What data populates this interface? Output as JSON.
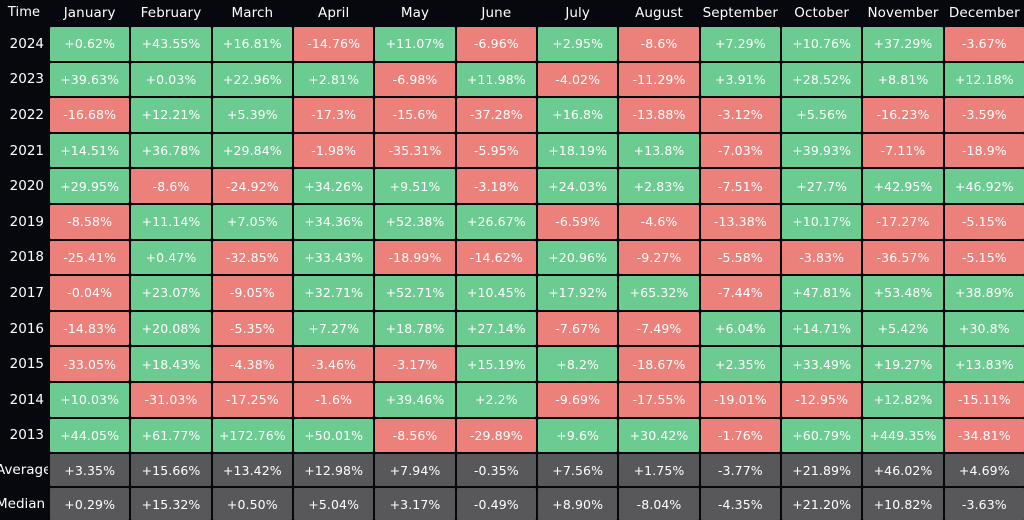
{
  "table": {
    "corner_label": "Time",
    "columns": [
      "January",
      "February",
      "March",
      "April",
      "May",
      "June",
      "July",
      "August",
      "September",
      "October",
      "November",
      "December"
    ],
    "colors": {
      "positive": "#6bcb90",
      "negative": "#ec807a",
      "neutral": "#58585a",
      "background": "#07080d",
      "text": "#ffffff"
    },
    "rows": [
      {
        "label": "2024",
        "type": "year",
        "values": [
          "+0.62%",
          "+43.55%",
          "+16.81%",
          "-14.76%",
          "+11.07%",
          "-6.96%",
          "+2.95%",
          "-8.6%",
          "+7.29%",
          "+10.76%",
          "+37.29%",
          "-3.67%"
        ]
      },
      {
        "label": "2023",
        "type": "year",
        "values": [
          "+39.63%",
          "+0.03%",
          "+22.96%",
          "+2.81%",
          "-6.98%",
          "+11.98%",
          "-4.02%",
          "-11.29%",
          "+3.91%",
          "+28.52%",
          "+8.81%",
          "+12.18%"
        ]
      },
      {
        "label": "2022",
        "type": "year",
        "values": [
          "-16.68%",
          "+12.21%",
          "+5.39%",
          "-17.3%",
          "-15.6%",
          "-37.28%",
          "+16.8%",
          "-13.88%",
          "-3.12%",
          "+5.56%",
          "-16.23%",
          "-3.59%"
        ]
      },
      {
        "label": "2021",
        "type": "year",
        "values": [
          "+14.51%",
          "+36.78%",
          "+29.84%",
          "-1.98%",
          "-35.31%",
          "-5.95%",
          "+18.19%",
          "+13.8%",
          "-7.03%",
          "+39.93%",
          "-7.11%",
          "-18.9%"
        ]
      },
      {
        "label": "2020",
        "type": "year",
        "values": [
          "+29.95%",
          "-8.6%",
          "-24.92%",
          "+34.26%",
          "+9.51%",
          "-3.18%",
          "+24.03%",
          "+2.83%",
          "-7.51%",
          "+27.7%",
          "+42.95%",
          "+46.92%"
        ]
      },
      {
        "label": "2019",
        "type": "year",
        "values": [
          "-8.58%",
          "+11.14%",
          "+7.05%",
          "+34.36%",
          "+52.38%",
          "+26.67%",
          "-6.59%",
          "-4.6%",
          "-13.38%",
          "+10.17%",
          "-17.27%",
          "-5.15%"
        ]
      },
      {
        "label": "2018",
        "type": "year",
        "values": [
          "-25.41%",
          "+0.47%",
          "-32.85%",
          "+33.43%",
          "-18.99%",
          "-14.62%",
          "+20.96%",
          "-9.27%",
          "-5.58%",
          "-3.83%",
          "-36.57%",
          "-5.15%"
        ]
      },
      {
        "label": "2017",
        "type": "year",
        "values": [
          "-0.04%",
          "+23.07%",
          "-9.05%",
          "+32.71%",
          "+52.71%",
          "+10.45%",
          "+17.92%",
          "+65.32%",
          "-7.44%",
          "+47.81%",
          "+53.48%",
          "+38.89%"
        ]
      },
      {
        "label": "2016",
        "type": "year",
        "values": [
          "-14.83%",
          "+20.08%",
          "-5.35%",
          "+7.27%",
          "+18.78%",
          "+27.14%",
          "-7.67%",
          "-7.49%",
          "+6.04%",
          "+14.71%",
          "+5.42%",
          "+30.8%"
        ]
      },
      {
        "label": "2015",
        "type": "year",
        "values": [
          "-33.05%",
          "+18.43%",
          "-4.38%",
          "-3.46%",
          "-3.17%",
          "+15.19%",
          "+8.2%",
          "-18.67%",
          "+2.35%",
          "+33.49%",
          "+19.27%",
          "+13.83%"
        ]
      },
      {
        "label": "2014",
        "type": "year",
        "values": [
          "+10.03%",
          "-31.03%",
          "-17.25%",
          "-1.6%",
          "+39.46%",
          "+2.2%",
          "-9.69%",
          "-17.55%",
          "-19.01%",
          "-12.95%",
          "+12.82%",
          "-15.11%"
        ]
      },
      {
        "label": "2013",
        "type": "year",
        "values": [
          "+44.05%",
          "+61.77%",
          "+172.76%",
          "+50.01%",
          "-8.56%",
          "-29.89%",
          "+9.6%",
          "+30.42%",
          "-1.76%",
          "+60.79%",
          "+449.35%",
          "-34.81%"
        ]
      },
      {
        "label": "Average",
        "type": "aggregate",
        "values": [
          "+3.35%",
          "+15.66%",
          "+13.42%",
          "+12.98%",
          "+7.94%",
          "-0.35%",
          "+7.56%",
          "+1.75%",
          "-3.77%",
          "+21.89%",
          "+46.02%",
          "+4.69%"
        ]
      },
      {
        "label": "Median",
        "type": "aggregate",
        "values": [
          "+0.29%",
          "+15.32%",
          "+0.50%",
          "+5.04%",
          "+3.17%",
          "-0.49%",
          "+8.90%",
          "-8.04%",
          "-4.35%",
          "+21.20%",
          "+10.82%",
          "-3.63%"
        ]
      }
    ]
  },
  "chart_data": {
    "type": "heatmap",
    "title": "",
    "xlabel": "",
    "ylabel": "Time",
    "categories": [
      "January",
      "February",
      "March",
      "April",
      "May",
      "June",
      "July",
      "August",
      "September",
      "October",
      "November",
      "December"
    ],
    "rows": [
      "2024",
      "2023",
      "2022",
      "2021",
      "2020",
      "2019",
      "2018",
      "2017",
      "2016",
      "2015",
      "2014",
      "2013",
      "Average",
      "Median"
    ],
    "units": "percent",
    "color_encoding": {
      "positive": "#6bcb90",
      "negative": "#ec807a",
      "aggregate_row": "#58585a"
    },
    "series": [
      {
        "name": "2024",
        "values": [
          0.62,
          43.55,
          16.81,
          -14.76,
          11.07,
          -6.96,
          2.95,
          -8.6,
          7.29,
          10.76,
          37.29,
          -3.67
        ]
      },
      {
        "name": "2023",
        "values": [
          39.63,
          0.03,
          22.96,
          2.81,
          -6.98,
          11.98,
          -4.02,
          -11.29,
          3.91,
          28.52,
          8.81,
          12.18
        ]
      },
      {
        "name": "2022",
        "values": [
          -16.68,
          12.21,
          5.39,
          -17.3,
          -15.6,
          -37.28,
          16.8,
          -13.88,
          -3.12,
          5.56,
          -16.23,
          -3.59
        ]
      },
      {
        "name": "2021",
        "values": [
          14.51,
          36.78,
          29.84,
          -1.98,
          -35.31,
          -5.95,
          18.19,
          13.8,
          -7.03,
          39.93,
          -7.11,
          -18.9
        ]
      },
      {
        "name": "2020",
        "values": [
          29.95,
          -8.6,
          -24.92,
          34.26,
          9.51,
          -3.18,
          24.03,
          2.83,
          -7.51,
          27.7,
          42.95,
          46.92
        ]
      },
      {
        "name": "2019",
        "values": [
          -8.58,
          11.14,
          7.05,
          34.36,
          52.38,
          26.67,
          -6.59,
          -4.6,
          -13.38,
          10.17,
          -17.27,
          -5.15
        ]
      },
      {
        "name": "2018",
        "values": [
          -25.41,
          0.47,
          -32.85,
          33.43,
          -18.99,
          -14.62,
          20.96,
          -9.27,
          -5.58,
          -3.83,
          -36.57,
          -5.15
        ]
      },
      {
        "name": "2017",
        "values": [
          -0.04,
          23.07,
          -9.05,
          32.71,
          52.71,
          10.45,
          17.92,
          65.32,
          -7.44,
          47.81,
          53.48,
          38.89
        ]
      },
      {
        "name": "2016",
        "values": [
          -14.83,
          20.08,
          -5.35,
          7.27,
          18.78,
          27.14,
          -7.67,
          -7.49,
          6.04,
          14.71,
          5.42,
          30.8
        ]
      },
      {
        "name": "2015",
        "values": [
          -33.05,
          18.43,
          -4.38,
          -3.46,
          -3.17,
          15.19,
          8.2,
          -18.67,
          2.35,
          33.49,
          19.27,
          13.83
        ]
      },
      {
        "name": "2014",
        "values": [
          10.03,
          -31.03,
          -17.25,
          -1.6,
          39.46,
          2.2,
          -9.69,
          -17.55,
          -19.01,
          -12.95,
          12.82,
          -15.11
        ]
      },
      {
        "name": "2013",
        "values": [
          44.05,
          61.77,
          172.76,
          50.01,
          -8.56,
          -29.89,
          9.6,
          30.42,
          -1.76,
          60.79,
          449.35,
          -34.81
        ]
      },
      {
        "name": "Average",
        "values": [
          3.35,
          15.66,
          13.42,
          12.98,
          7.94,
          -0.35,
          7.56,
          1.75,
          -3.77,
          21.89,
          46.02,
          4.69
        ]
      },
      {
        "name": "Median",
        "values": [
          0.29,
          15.32,
          0.5,
          5.04,
          3.17,
          -0.49,
          8.9,
          -8.04,
          -4.35,
          21.2,
          10.82,
          -3.63
        ]
      }
    ]
  }
}
